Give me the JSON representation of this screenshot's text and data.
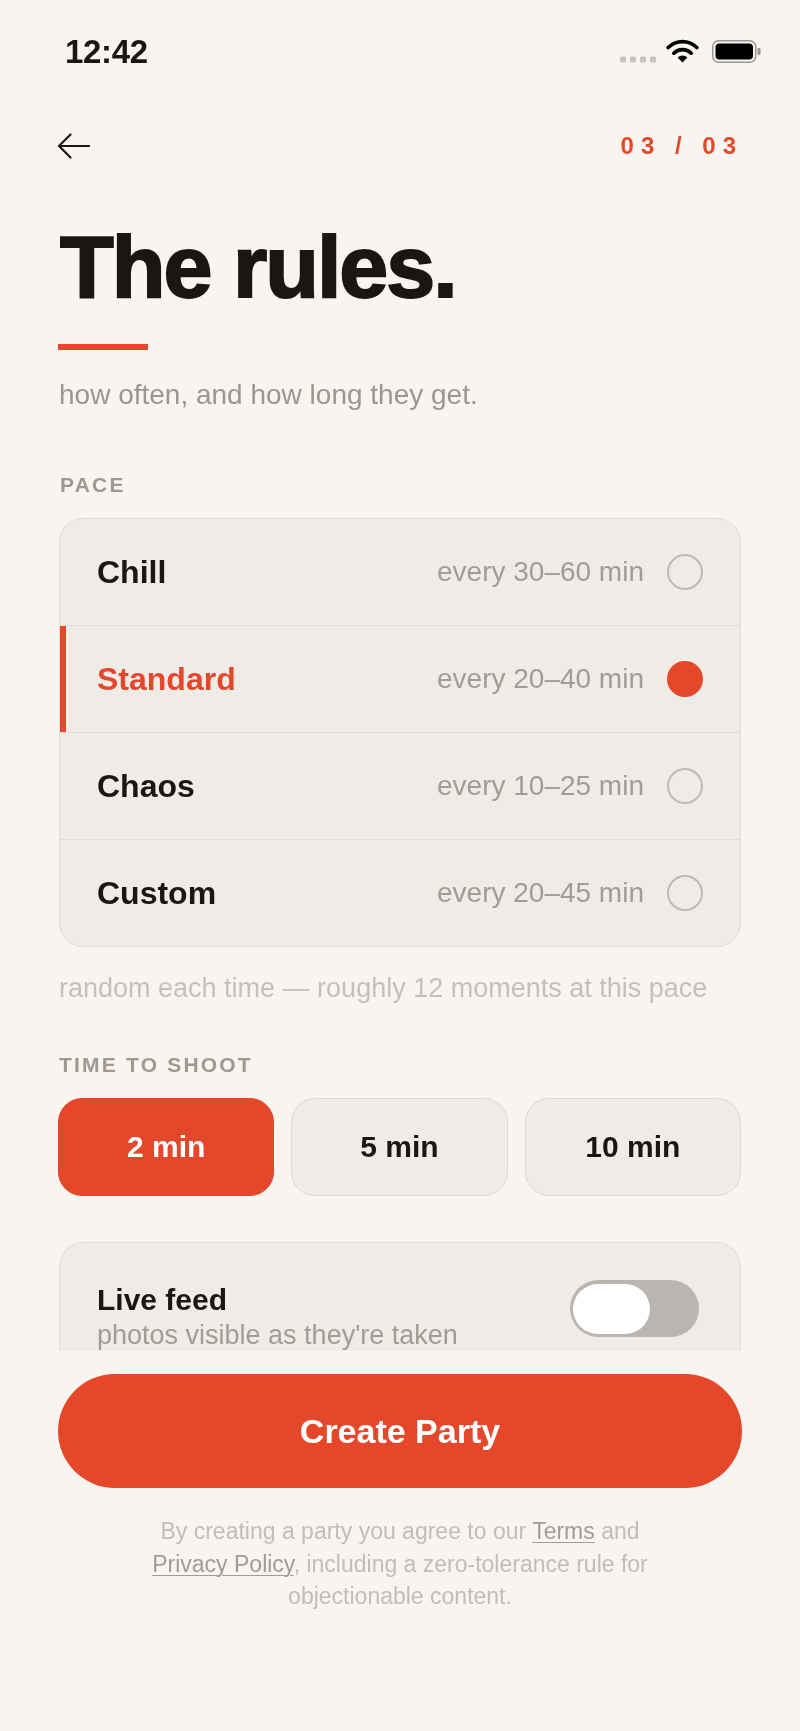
{
  "status_bar": {
    "time": "12:42"
  },
  "nav": {
    "step": "03 / 03"
  },
  "header": {
    "title": "The rules.",
    "subtitle": "how often, and how long they get."
  },
  "pace": {
    "label": "PACE",
    "options": [
      {
        "name": "Chill",
        "range": "every 30–60 min",
        "selected": false
      },
      {
        "name": "Standard",
        "range": "every 20–40 min",
        "selected": true
      },
      {
        "name": "Chaos",
        "range": "every 10–25 min",
        "selected": false
      },
      {
        "name": "Custom",
        "range": "every 20–45 min",
        "selected": false
      }
    ],
    "hint": "random each time — roughly 12 moments at this pace"
  },
  "time_to_shoot": {
    "label": "TIME TO SHOOT",
    "options": [
      {
        "label": "2 min",
        "selected": true
      },
      {
        "label": "5 min",
        "selected": false
      },
      {
        "label": "10 min",
        "selected": false
      }
    ]
  },
  "settings": [
    {
      "title": "Live feed",
      "description": "photos visible as they're taken",
      "on": false
    }
  ],
  "primary_button": "Create Party",
  "legal": [
    {
      "kind": "text",
      "text": "By creating a party you agree to our "
    },
    {
      "kind": "link",
      "text": "Terms"
    },
    {
      "kind": "text",
      "text": " and "
    },
    {
      "kind": "link",
      "text": "Privacy Policy"
    },
    {
      "kind": "text",
      "text": ", including a zero-tolerance rule for objectionable content."
    }
  ]
}
